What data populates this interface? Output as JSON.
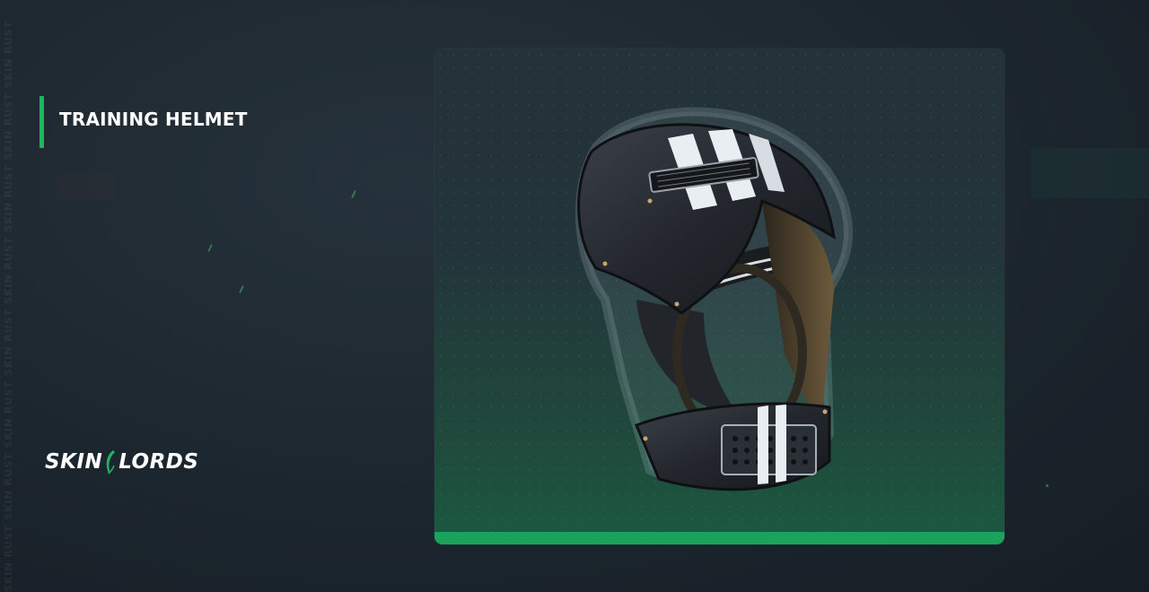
{
  "item": {
    "name": "TRAINING HELMET"
  },
  "brand": {
    "logo_left": "SKIN",
    "logo_right": "LORDS",
    "accent_color": "#1fb463"
  },
  "watermark": {
    "text": "SKIN RUST SKIN RUST SKIN RUST SKIN RUST SKIN RUST SKIN RUST SKIN RUST SKIN RUST"
  },
  "card": {
    "image": "training-helmet-image",
    "bar_color": "#1aa35a"
  }
}
